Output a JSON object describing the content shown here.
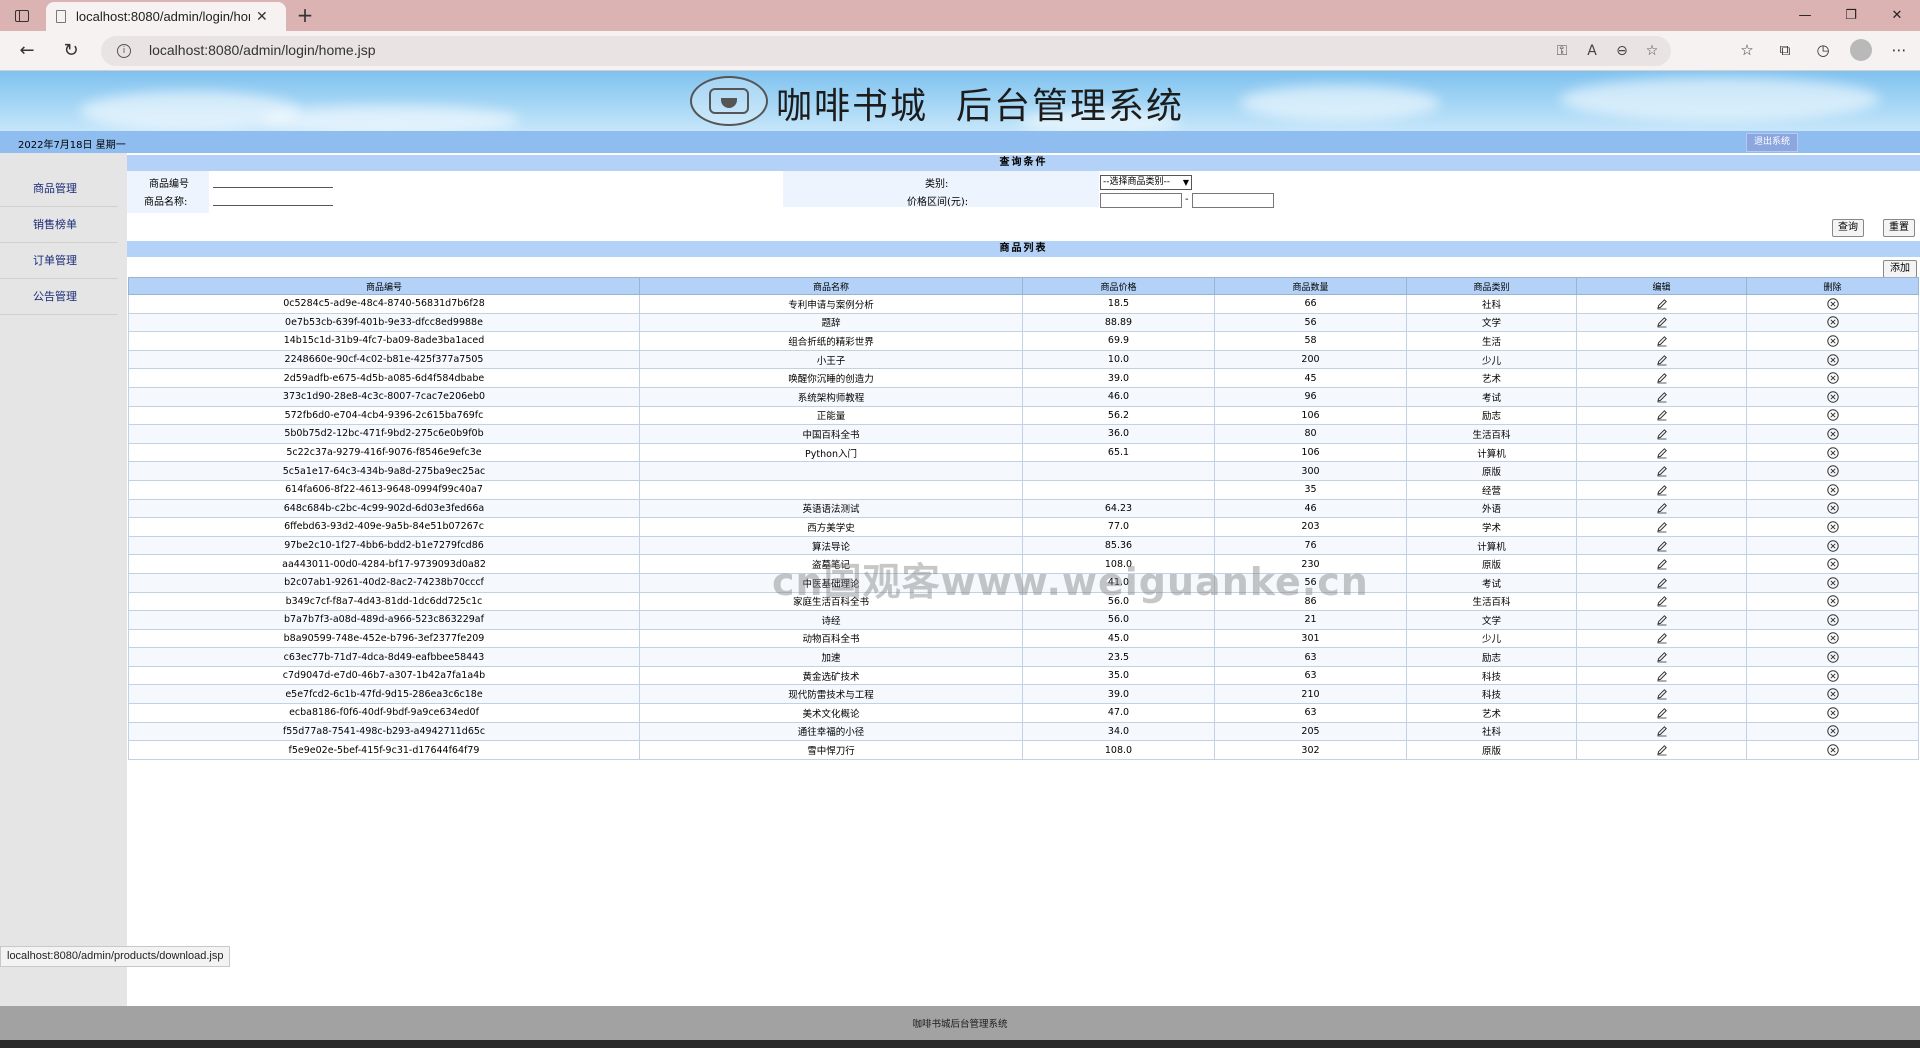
{
  "browser": {
    "tab_title": "localhost:8080/admin/login/home.jsp",
    "url": "localhost:8080/admin/login/home.jsp",
    "status_url": "localhost:8080/admin/products/download.jsp"
  },
  "header": {
    "title_left": "咖啡书城",
    "title_right": "后台管理系统",
    "date": "2022年7月18日 星期一",
    "logout_label": "退出系统"
  },
  "sidebar": {
    "items": [
      {
        "label": "商品管理"
      },
      {
        "label": "销售榜单"
      },
      {
        "label": "订单管理"
      },
      {
        "label": "公告管理"
      }
    ]
  },
  "query": {
    "title": "查询条件",
    "id_label": "商品编号",
    "name_label": "商品名称:",
    "category_label": "类别:",
    "category_selected": "--选择商品类别--",
    "price_label": "价格区间(元):",
    "price_sep": "-",
    "search_label": "查询",
    "reset_label": "重置"
  },
  "list": {
    "title": "商品列表",
    "add_label": "添加",
    "headers": [
      "商品编号",
      "商品名称",
      "商品价格",
      "商品数量",
      "商品类别",
      "编辑",
      "删除"
    ],
    "rows": [
      [
        "0c5284c5-ad9e-48c4-8740-56831d7b6f28",
        "专利申请与案例分析",
        "18.5",
        "66",
        "社科"
      ],
      [
        "0e7b53cb-639f-401b-9e33-dfcc8ed9988e",
        "题辞",
        "88.89",
        "56",
        "文学"
      ],
      [
        "14b15c1d-31b9-4fc7-ba09-8ade3ba1aced",
        "组合折纸的精彩世界",
        "69.9",
        "58",
        "生活"
      ],
      [
        "2248660e-90cf-4c02-b81e-425f377a7505",
        "小王子",
        "10.0",
        "200",
        "少儿"
      ],
      [
        "2d59adfb-e675-4d5b-a085-6d4f584dbabe",
        "唤醒你沉睡的创造力",
        "39.0",
        "45",
        "艺术"
      ],
      [
        "373c1d90-28e8-4c3c-8007-7cac7e206eb0",
        "系统架构师教程",
        "46.0",
        "96",
        "考试"
      ],
      [
        "572fb6d0-e704-4cb4-9396-2c615ba769fc",
        "正能量",
        "56.2",
        "106",
        "励志"
      ],
      [
        "5b0b75d2-12bc-471f-9bd2-275c6e0b9f0b",
        "中国百科全书",
        "36.0",
        "80",
        "生活百科"
      ],
      [
        "5c22c37a-9279-416f-9076-f8546e9efc3e",
        "Python入门",
        "65.1",
        "106",
        "计算机"
      ],
      [
        "5c5a1e17-64c3-434b-9a8d-275ba9ec25ac",
        "",
        "",
        "300",
        "原版"
      ],
      [
        "614fa606-8f22-4613-9648-0994f99c40a7",
        "",
        "",
        "35",
        "经营"
      ],
      [
        "648c684b-c2bc-4c99-902d-6d03e3fed66a",
        "英语语法测试",
        "64.23",
        "46",
        "外语"
      ],
      [
        "6ffebd63-93d2-409e-9a5b-84e51b07267c",
        "西方美学史",
        "77.0",
        "203",
        "学术"
      ],
      [
        "97be2c10-1f27-4bb6-bdd2-b1e7279fcd86",
        "算法导论",
        "85.36",
        "76",
        "计算机"
      ],
      [
        "aa443011-00d0-4284-bf17-9739093d0a82",
        "盗墓笔记",
        "108.0",
        "230",
        "原版"
      ],
      [
        "b2c07ab1-9261-40d2-8ac2-74238b70cccf",
        "中医基础理论",
        "41.0",
        "56",
        "考试"
      ],
      [
        "b349c7cf-f8a7-4d43-81dd-1dc6dd725c1c",
        "家庭生活百科全书",
        "56.0",
        "86",
        "生活百科"
      ],
      [
        "b7a7b7f3-a08d-489d-a966-523c863229af",
        "诗经",
        "56.0",
        "21",
        "文学"
      ],
      [
        "b8a90599-748e-452e-b796-3ef2377fe209",
        "动物百科全书",
        "45.0",
        "301",
        "少儿"
      ],
      [
        "c63ec77b-71d7-4dca-8d49-eafbbee58443",
        "加速",
        "23.5",
        "63",
        "励志"
      ],
      [
        "c7d9047d-e7d0-46b7-a307-1b42a7fa1a4b",
        "黄金选矿技术",
        "35.0",
        "63",
        "科技"
      ],
      [
        "e5e7fcd2-6c1b-47fd-9d15-286ea3c6c18e",
        "现代防雷技术与工程",
        "39.0",
        "210",
        "科技"
      ],
      [
        "ecba8186-f0f6-40df-9bdf-9a9ce634ed0f",
        "美术文化概论",
        "47.0",
        "63",
        "艺术"
      ],
      [
        "f55d77a8-7541-498c-b293-a4942711d65c",
        "通往幸福的小径",
        "34.0",
        "205",
        "社科"
      ],
      [
        "f5e9e02e-5bef-415f-9c31-d17644f64f79",
        "雪中悍刀行",
        "108.0",
        "302",
        "原版"
      ]
    ]
  },
  "watermark": "cn国观客www.weiguanke.cn",
  "footer": {
    "text": "咖啡书城后台管理系统"
  },
  "colors": {
    "header_bar": "#8fbdf0",
    "section_head": "#b4d2f7",
    "sidebar_bg": "#e5e5e5",
    "link": "#1a2b78"
  }
}
